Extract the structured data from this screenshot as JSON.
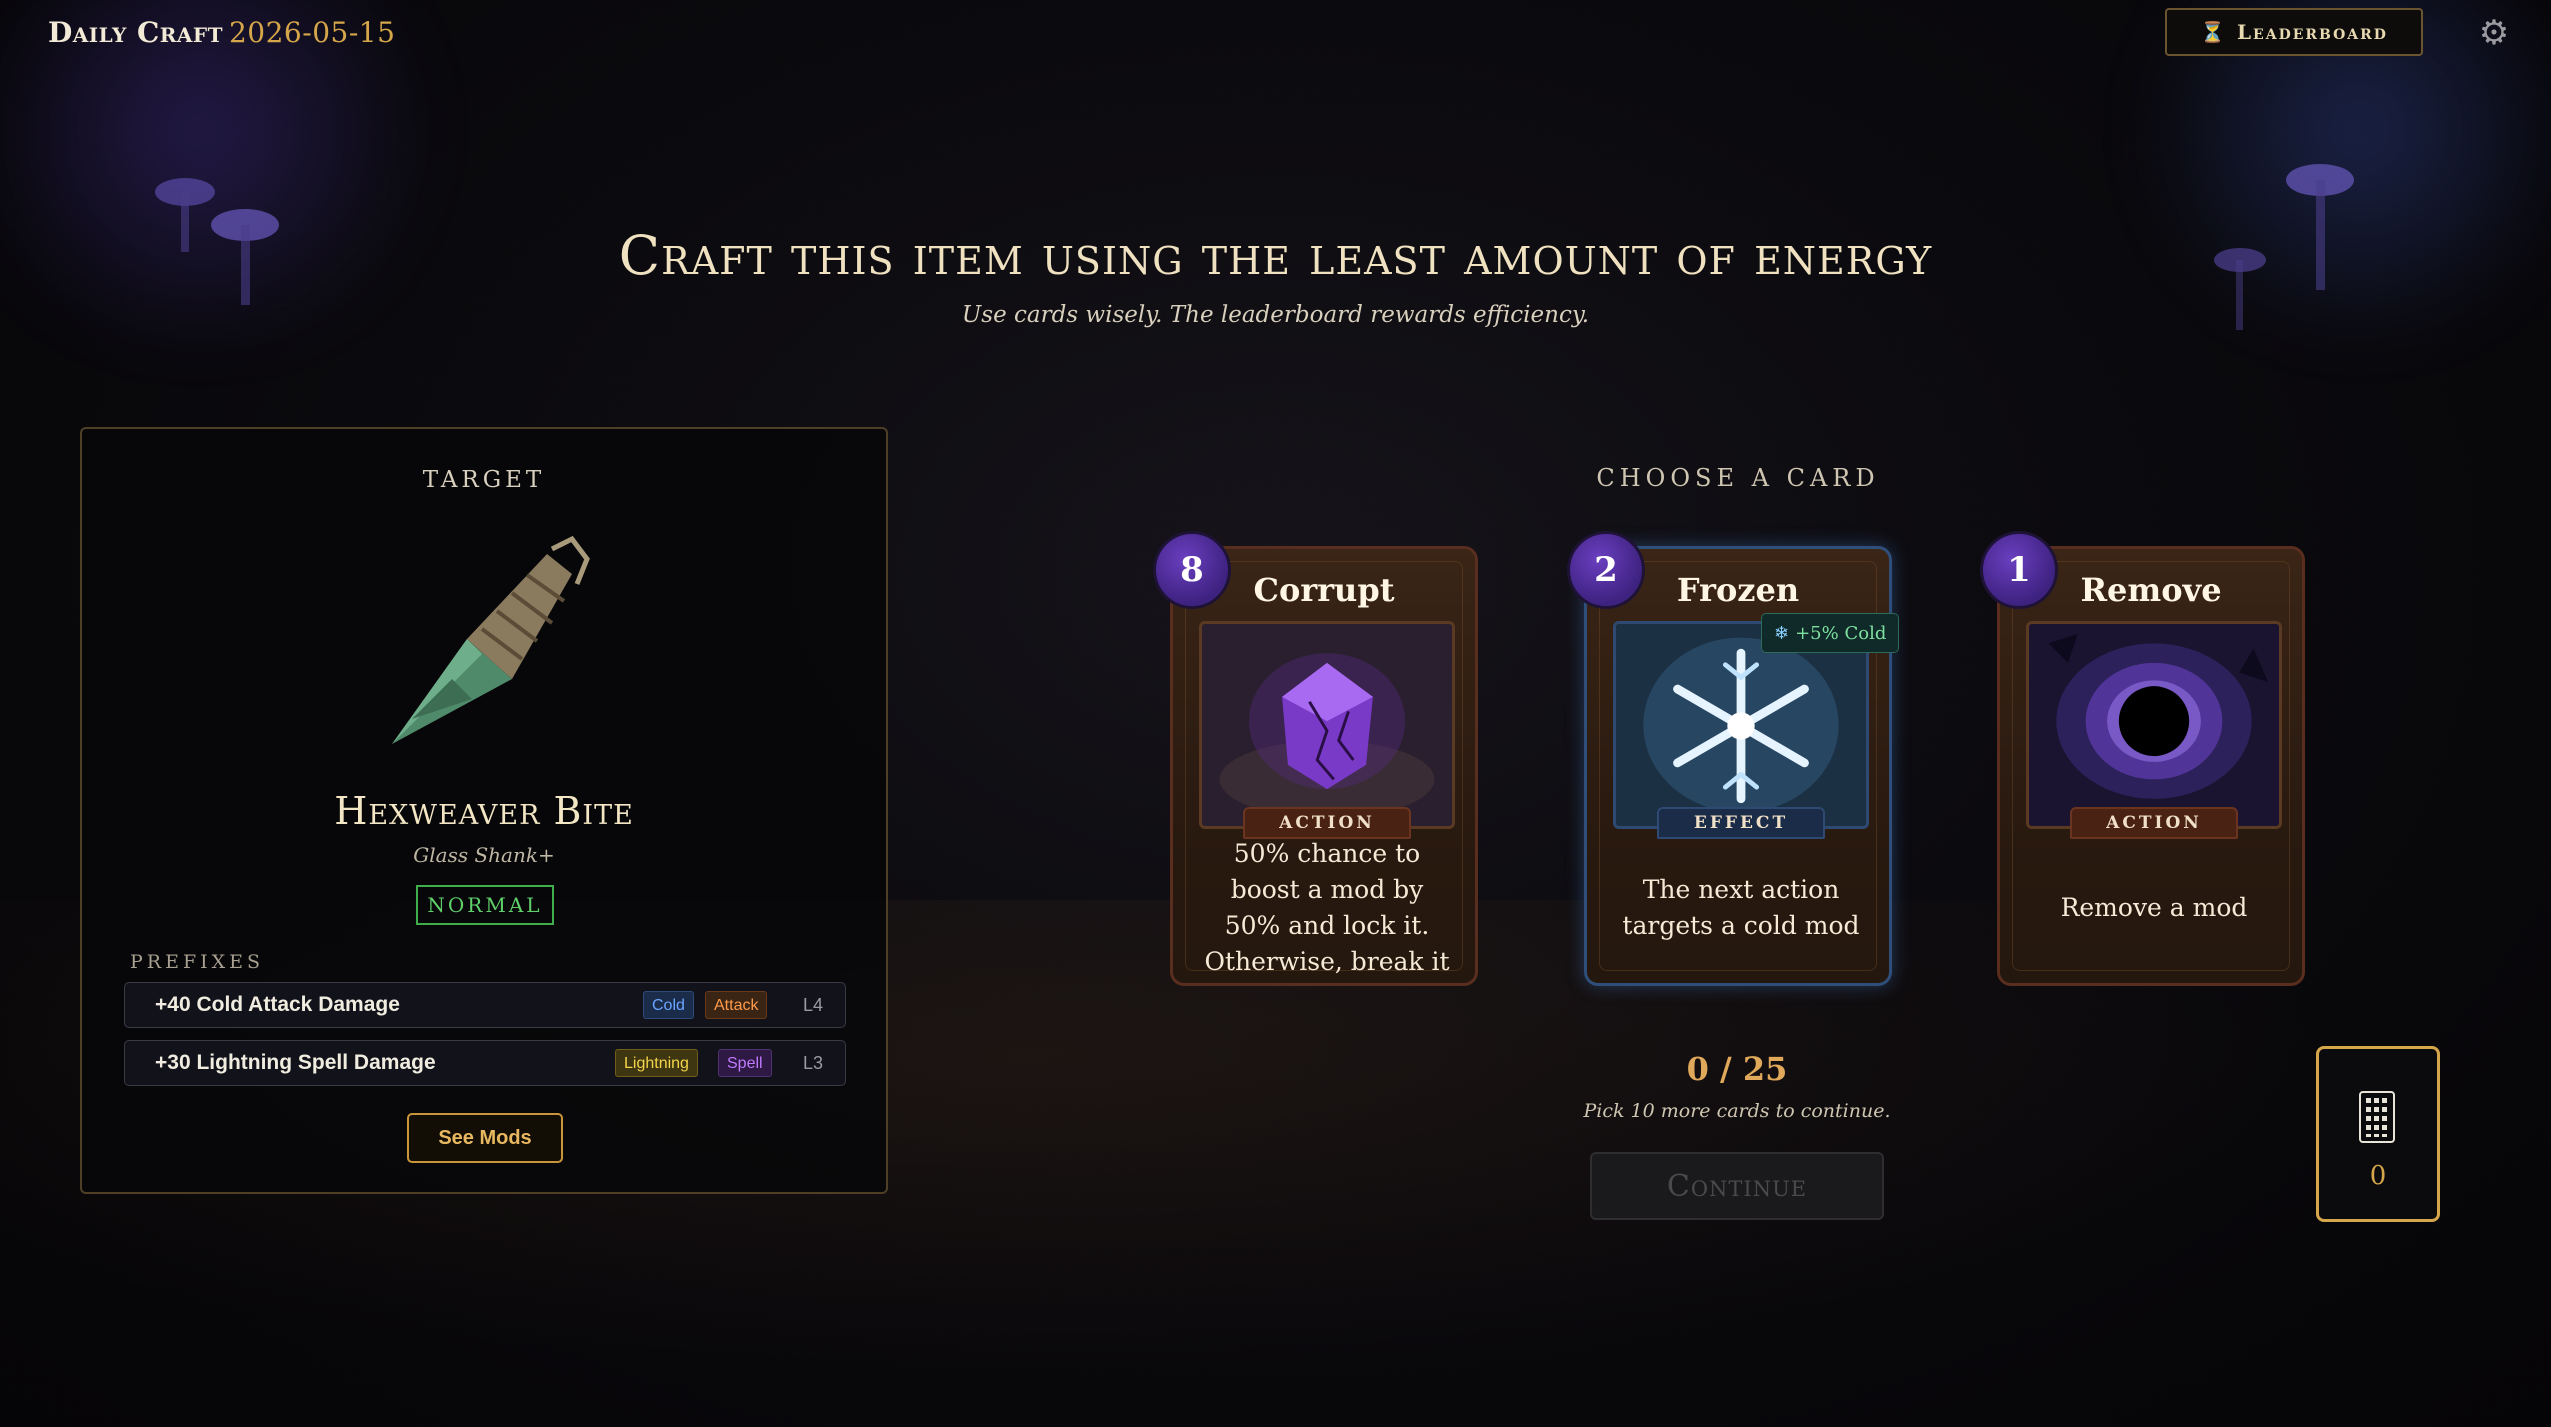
{
  "header": {
    "app_title": "Daily Craft",
    "date": "2026-05-15",
    "leaderboard_label": "Leaderboard",
    "trophy_icon": "trophy-icon",
    "settings_icon": "gear-icon"
  },
  "headline": {
    "title": "Craft this item using the least amount of energy",
    "subtitle": "Use cards wisely. The leaderboard rewards efficiency."
  },
  "target": {
    "label": "TARGET",
    "item_name": "Hexweaver Bite",
    "item_base": "Glass Shank+",
    "rarity": "NORMAL",
    "rarity_color": "#3fae4a",
    "prefixes_label": "PREFIXES",
    "mods": [
      {
        "text": "+40 Cold Attack Damage",
        "tags": [
          "Cold",
          "Attack"
        ],
        "level": "L4"
      },
      {
        "text": "+30 Lightning Spell Damage",
        "tags": [
          "Lightning",
          "Spell"
        ],
        "level": "L3"
      }
    ],
    "see_mods_label": "See Mods"
  },
  "cards_section": {
    "label": "CHOOSE A CARD",
    "cards": [
      {
        "cost": "8",
        "name": "Corrupt",
        "type": "ACTION",
        "description": "50% chance to boost a mod by 50% and lock it. Otherwise, break it",
        "art": "purple-crystal"
      },
      {
        "cost": "2",
        "name": "Frozen",
        "type": "EFFECT",
        "description": "The next action targets a cold mod",
        "chip": "+5% Cold",
        "art": "snowflake"
      },
      {
        "cost": "1",
        "name": "Remove",
        "type": "ACTION",
        "description": "Remove a mod",
        "art": "void-portal"
      }
    ]
  },
  "progress": {
    "count": "0 / 25",
    "hint": "Pick 10 more cards to continue.",
    "continue_label": "Continue"
  },
  "deck": {
    "count": "0",
    "icon": "deck-icon"
  },
  "colors": {
    "accent_gold": "#d6a64a",
    "energy_purple": "#5a34b0"
  }
}
